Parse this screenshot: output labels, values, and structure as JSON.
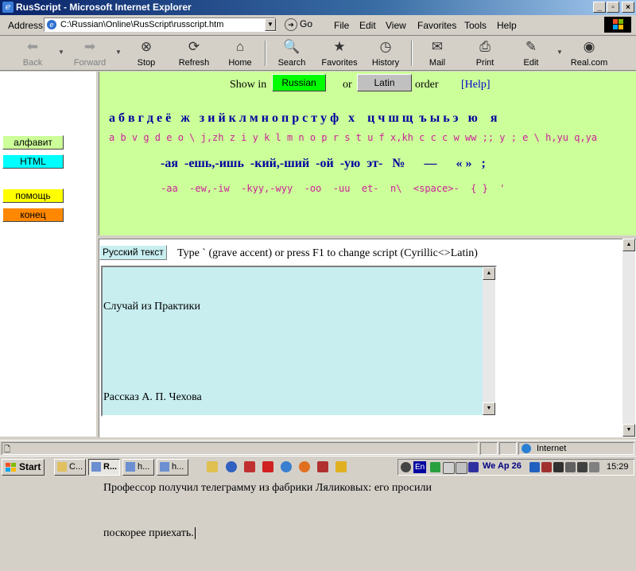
{
  "window": {
    "title": "RusScript - Microsoft Internet Explorer",
    "controls": [
      "_",
      "▫",
      "×"
    ]
  },
  "addressbar": {
    "label": "Address",
    "value": "C:\\Russian\\Online\\RusScript\\russcript.htm",
    "go_label": "Go"
  },
  "menu": [
    "File",
    "Edit",
    "View",
    "Favorites",
    "Tools",
    "Help"
  ],
  "toolbar": {
    "back": "Back",
    "forward": "Forward",
    "stop": "Stop",
    "refresh": "Refresh",
    "home": "Home",
    "search": "Search",
    "favorites": "Favorites",
    "history": "History",
    "mail": "Mail",
    "print": "Print",
    "edit": "Edit",
    "realcom": "Real.com"
  },
  "sidebar": {
    "alphabet": "алфавит",
    "html": "HTML",
    "help": "помощь",
    "end": "конец",
    "colors": {
      "alphabet": "#ccff99",
      "html": "#00ffff",
      "help": "#ffff00",
      "end": "#ff8800"
    }
  },
  "alphabet_frame": {
    "show_in": "Show in",
    "russian_btn": "Russian",
    "or": "or",
    "latin_btn": "Latin",
    "order": "order",
    "help_link": "[Help]",
    "cyrillic_row": "а б в г д е ё   ж   з и й к л м н о п р с т у ф   х    ц ч ш щ  ъ ы ь э   ю    я",
    "latin_row": "a b v g d e o \\ j,zh z i y k l m n o p r s t u f x,kh c c c w ww ;; y ; e \\ h,yu q,ya",
    "endings_row": "-ая  -ешь,-ишь  -кий,-ший  -ой  -ую  эт-   №      —      « »   ;",
    "endings_latin_row": "-aa  -ew,-iw  -kyy,-wyy  -oo  -uu  et-  n\\  <space>-  { }  '",
    "colors": {
      "background": "#ccff99",
      "cyrillic": "#0000a0",
      "latin": "#cc2299",
      "russian_btn": "#00ff00",
      "latin_btn": "#c0c0c0"
    }
  },
  "editor": {
    "mode_badge": "Русский текст",
    "instruction": "Type ` (grave accent) or press F1 to change script (Cyrillic<>Latin)",
    "lines": [
      "Случай из Практики",
      "",
      "Рассказ А. П. Чехова",
      "",
      "Профессор получил телеграмму из фабрики Ляликовых: его просили",
      "поскорее приехать."
    ],
    "background": "#c8eef0"
  },
  "statusbar": {
    "zone": "Internet"
  },
  "taskbar": {
    "start": "Start",
    "tasks": [
      "C...",
      "R...",
      "h...",
      "h..."
    ],
    "tray_lang": "En",
    "tray_date": "We Ap 26",
    "clock": "15:29"
  }
}
